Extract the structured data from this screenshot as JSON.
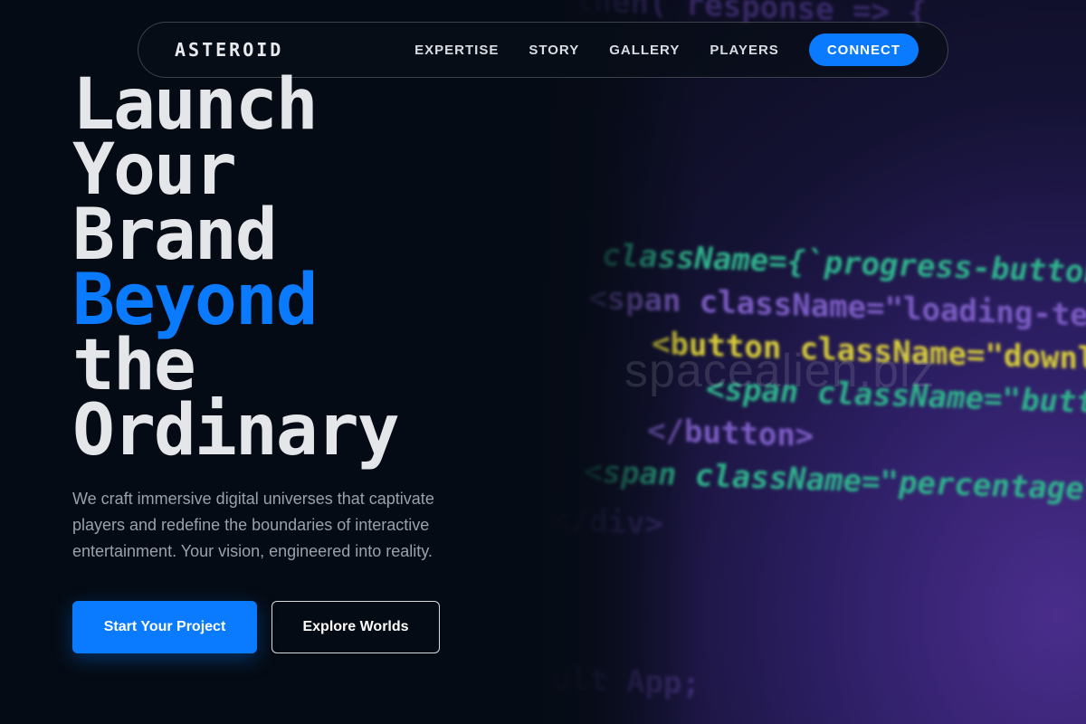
{
  "nav": {
    "logo": "ASTEROID",
    "links": [
      "EXPERTISE",
      "STORY",
      "GALLERY",
      "PLAYERS"
    ],
    "connect_label": "CONNECT"
  },
  "hero": {
    "title_lines": [
      "Launch",
      "Your",
      "Brand"
    ],
    "title_accent": "Beyond",
    "title_lines_after": [
      "the",
      "Ordinary"
    ],
    "description": "We craft immersive digital universes that captivate players and redefine the boundaries of interactive entertainment. Your vision, engineered into reality.",
    "primary_button": "Start Your Project",
    "secondary_button": "Explore Worlds"
  },
  "background": {
    "watermark": "spacealien.biz",
    "code_lines": [
      "then( response => {",
      "className={`progress-button ${progre",
      "<span className=\"loading-text\" Loadi",
      "<button className=\"download-butto",
      "<span className=\"button-text",
      "</button>",
      "<span className=\"percentage\" {percen",
      "</div>",
      "ult App;"
    ]
  },
  "colors": {
    "accent": "#0a7bff",
    "background": "#050b14",
    "heading": "#e4e6ea",
    "body_text": "#9aa1ab"
  }
}
